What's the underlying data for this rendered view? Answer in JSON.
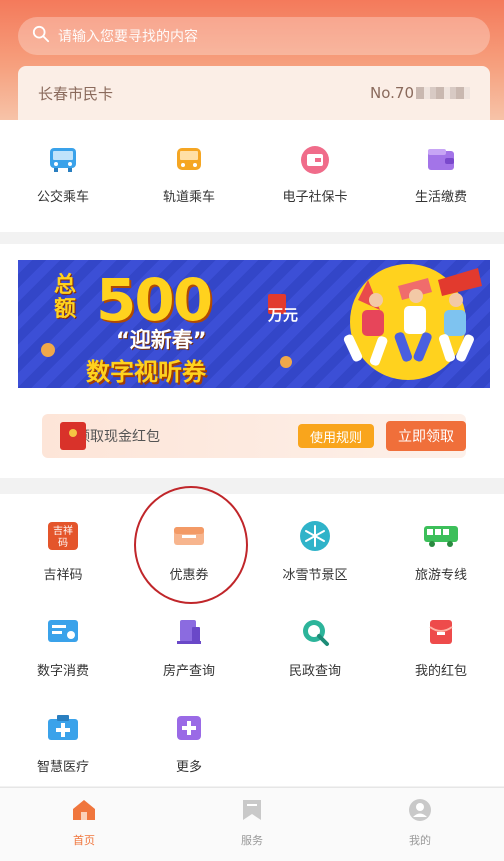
{
  "search": {
    "placeholder": "请输入您要寻找的内容"
  },
  "card": {
    "title": "长春市民卡",
    "number": "No.70"
  },
  "quick_actions": [
    {
      "label": "公交乘车",
      "icon": "bus-icon"
    },
    {
      "label": "轨道乘车",
      "icon": "metro-icon"
    },
    {
      "label": "电子社保卡",
      "icon": "social-card-icon"
    },
    {
      "label": "生活缴费",
      "icon": "wallet-icon"
    }
  ],
  "banner": {
    "total_label": "总额",
    "amount": "500",
    "unit": "万元",
    "line1": "“迎新春”",
    "line2": "数字视听券"
  },
  "red_packet": {
    "label": "领取现金红包",
    "rule_button": "使用规则",
    "claim_button": "立即领取"
  },
  "services": [
    {
      "label": "吉祥码",
      "icon": "jixiang-code-icon"
    },
    {
      "label": "优惠券",
      "icon": "coupon-icon"
    },
    {
      "label": "冰雪节景区",
      "icon": "snowflake-icon"
    },
    {
      "label": "旅游专线",
      "icon": "tour-bus-icon"
    },
    {
      "label": "数字消费",
      "icon": "digital-consume-icon"
    },
    {
      "label": "房产查询",
      "icon": "property-icon"
    },
    {
      "label": "民政查询",
      "icon": "civil-search-icon"
    },
    {
      "label": "我的红包",
      "icon": "red-packet-icon"
    },
    {
      "label": "智慧医疗",
      "icon": "medical-icon"
    },
    {
      "label": "更多",
      "icon": "more-icon"
    }
  ],
  "tabs": [
    {
      "label": "首页",
      "icon": "home-icon",
      "active": true
    },
    {
      "label": "服务",
      "icon": "service-icon",
      "active": false
    },
    {
      "label": "我的",
      "icon": "profile-icon",
      "active": false
    }
  ],
  "colors": {
    "accent": "#f0763d",
    "highlight_circle": "#c0262a"
  }
}
